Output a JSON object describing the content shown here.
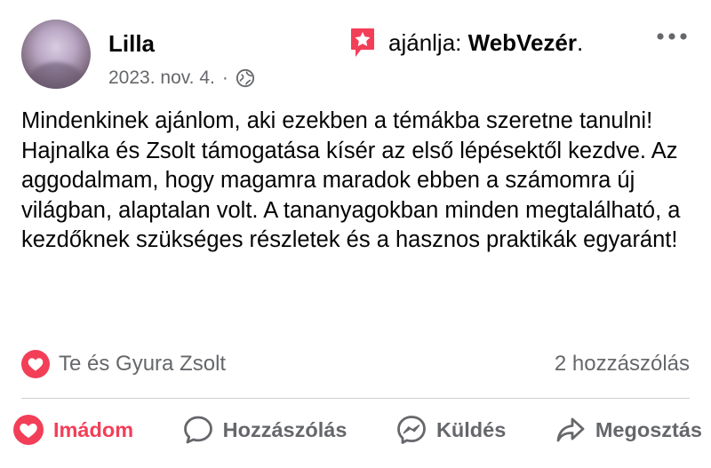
{
  "author": {
    "name": "Lilla",
    "date": "2023. nov. 4.",
    "separator": "·"
  },
  "recommendation": {
    "verb": "ajánlja:",
    "page": "WebVezér",
    "suffix": "."
  },
  "post_text": "Mindenkinek ajánlom, aki ezekben a témákba szeretne tanulni! Hajnalka és Zsolt támogatása kísér az első lépésektől kezdve. Az aggodalmam, hogy magamra maradok ebben a számomra új világban, alaptalan volt. A tananyagokban minden megtalálható, a kezdőknek szükséges részletek és a hasznos praktikák egyaránt!",
  "stats": {
    "reactors": "Te és Gyura Zsolt",
    "comments": "2 hozzászólás"
  },
  "actions": {
    "love": "Imádom",
    "comment": "Hozzászólás",
    "send": "Küldés",
    "share": "Megosztás"
  },
  "colors": {
    "love": "#f33e58",
    "muted": "#65676b",
    "text": "#050505"
  }
}
